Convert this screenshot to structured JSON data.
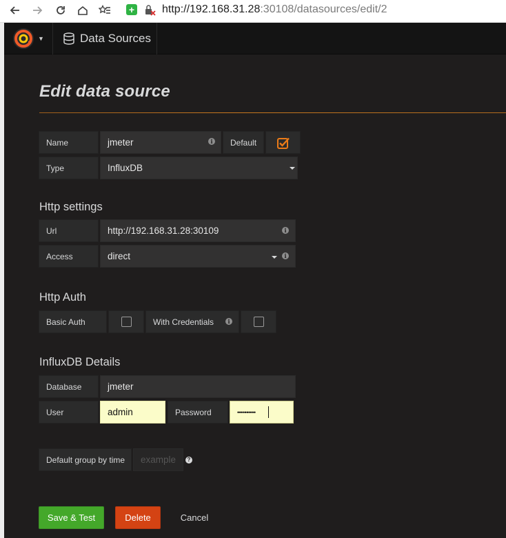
{
  "browser": {
    "url_host": "http://192.168.31.28",
    "url_rest": ":30108/datasources/edit/2"
  },
  "nav": {
    "breadcrumb": "Data Sources"
  },
  "page": {
    "title": "Edit data source"
  },
  "general": {
    "name_label": "Name",
    "name_value": "jmeter",
    "default_label": "Default",
    "default_checked": true,
    "type_label": "Type",
    "type_value": "InfluxDB"
  },
  "http": {
    "heading": "Http settings",
    "url_label": "Url",
    "url_value": "http://192.168.31.28:30109",
    "access_label": "Access",
    "access_value": "direct"
  },
  "auth": {
    "heading": "Http Auth",
    "basic_label": "Basic Auth",
    "basic_checked": false,
    "credentials_label": "With Credentials",
    "credentials_checked": false
  },
  "influx": {
    "heading": "InfluxDB Details",
    "database_label": "Database",
    "database_value": "jmeter",
    "user_label": "User",
    "user_value": "admin",
    "password_label": "Password",
    "password_value": "••••••••••",
    "group_label": "Default group by time",
    "group_placeholder": "example"
  },
  "actions": {
    "save": "Save & Test",
    "delete": "Delete",
    "cancel": "Cancel"
  },
  "colors": {
    "save": "#44a82a",
    "delete": "#d44313",
    "accent": "#eb7b18",
    "autofill": "#fbfcc9"
  }
}
